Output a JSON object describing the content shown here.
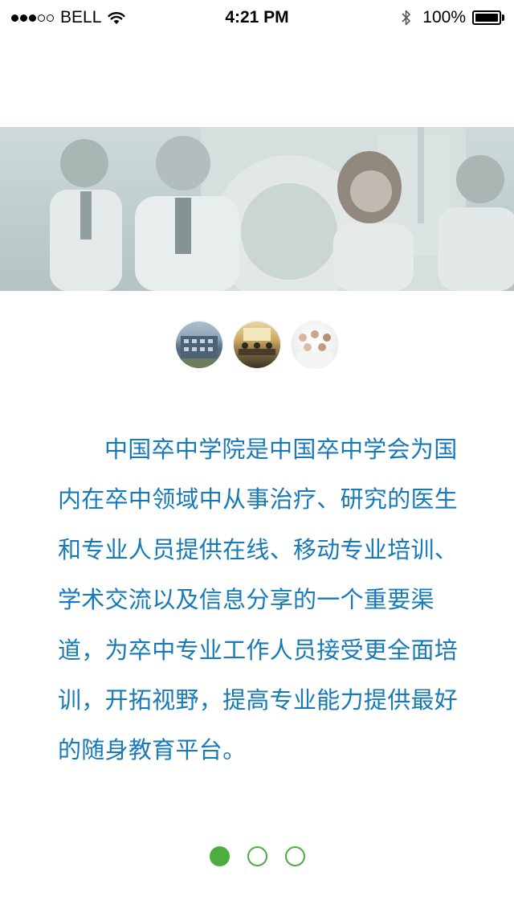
{
  "status_bar": {
    "carrier": "BELL",
    "signal_bars_filled": 3,
    "signal_bars_total": 5,
    "time": "4:21 PM",
    "battery_percent": "100%",
    "icons": [
      "wifi-icon",
      "bluetooth-icon",
      "battery-icon"
    ]
  },
  "hero": {
    "image": "banner photo of medical doctors in white coats in front of an MRI scanner"
  },
  "thumbnails": [
    {
      "name": "building-photo"
    },
    {
      "name": "meeting-room-photo"
    },
    {
      "name": "doctors-group-photo"
    }
  ],
  "description": {
    "text": "中国卒中学院是中国卒中学会为国内在卒中领域中从事治疗、研究的医生和专业人员提供在线、移动专业培训、学术交流以及信息分享的一个重要渠道，为卒中专业工作人员接受更全面培训，开拓视野，提高专业能力提供最好的随身教育平台。"
  },
  "pager": {
    "total": 3,
    "active_index": 0
  },
  "colors": {
    "text_blue": "#1779b8",
    "pager_green": "#4bae3f",
    "background": "#ffffff"
  }
}
